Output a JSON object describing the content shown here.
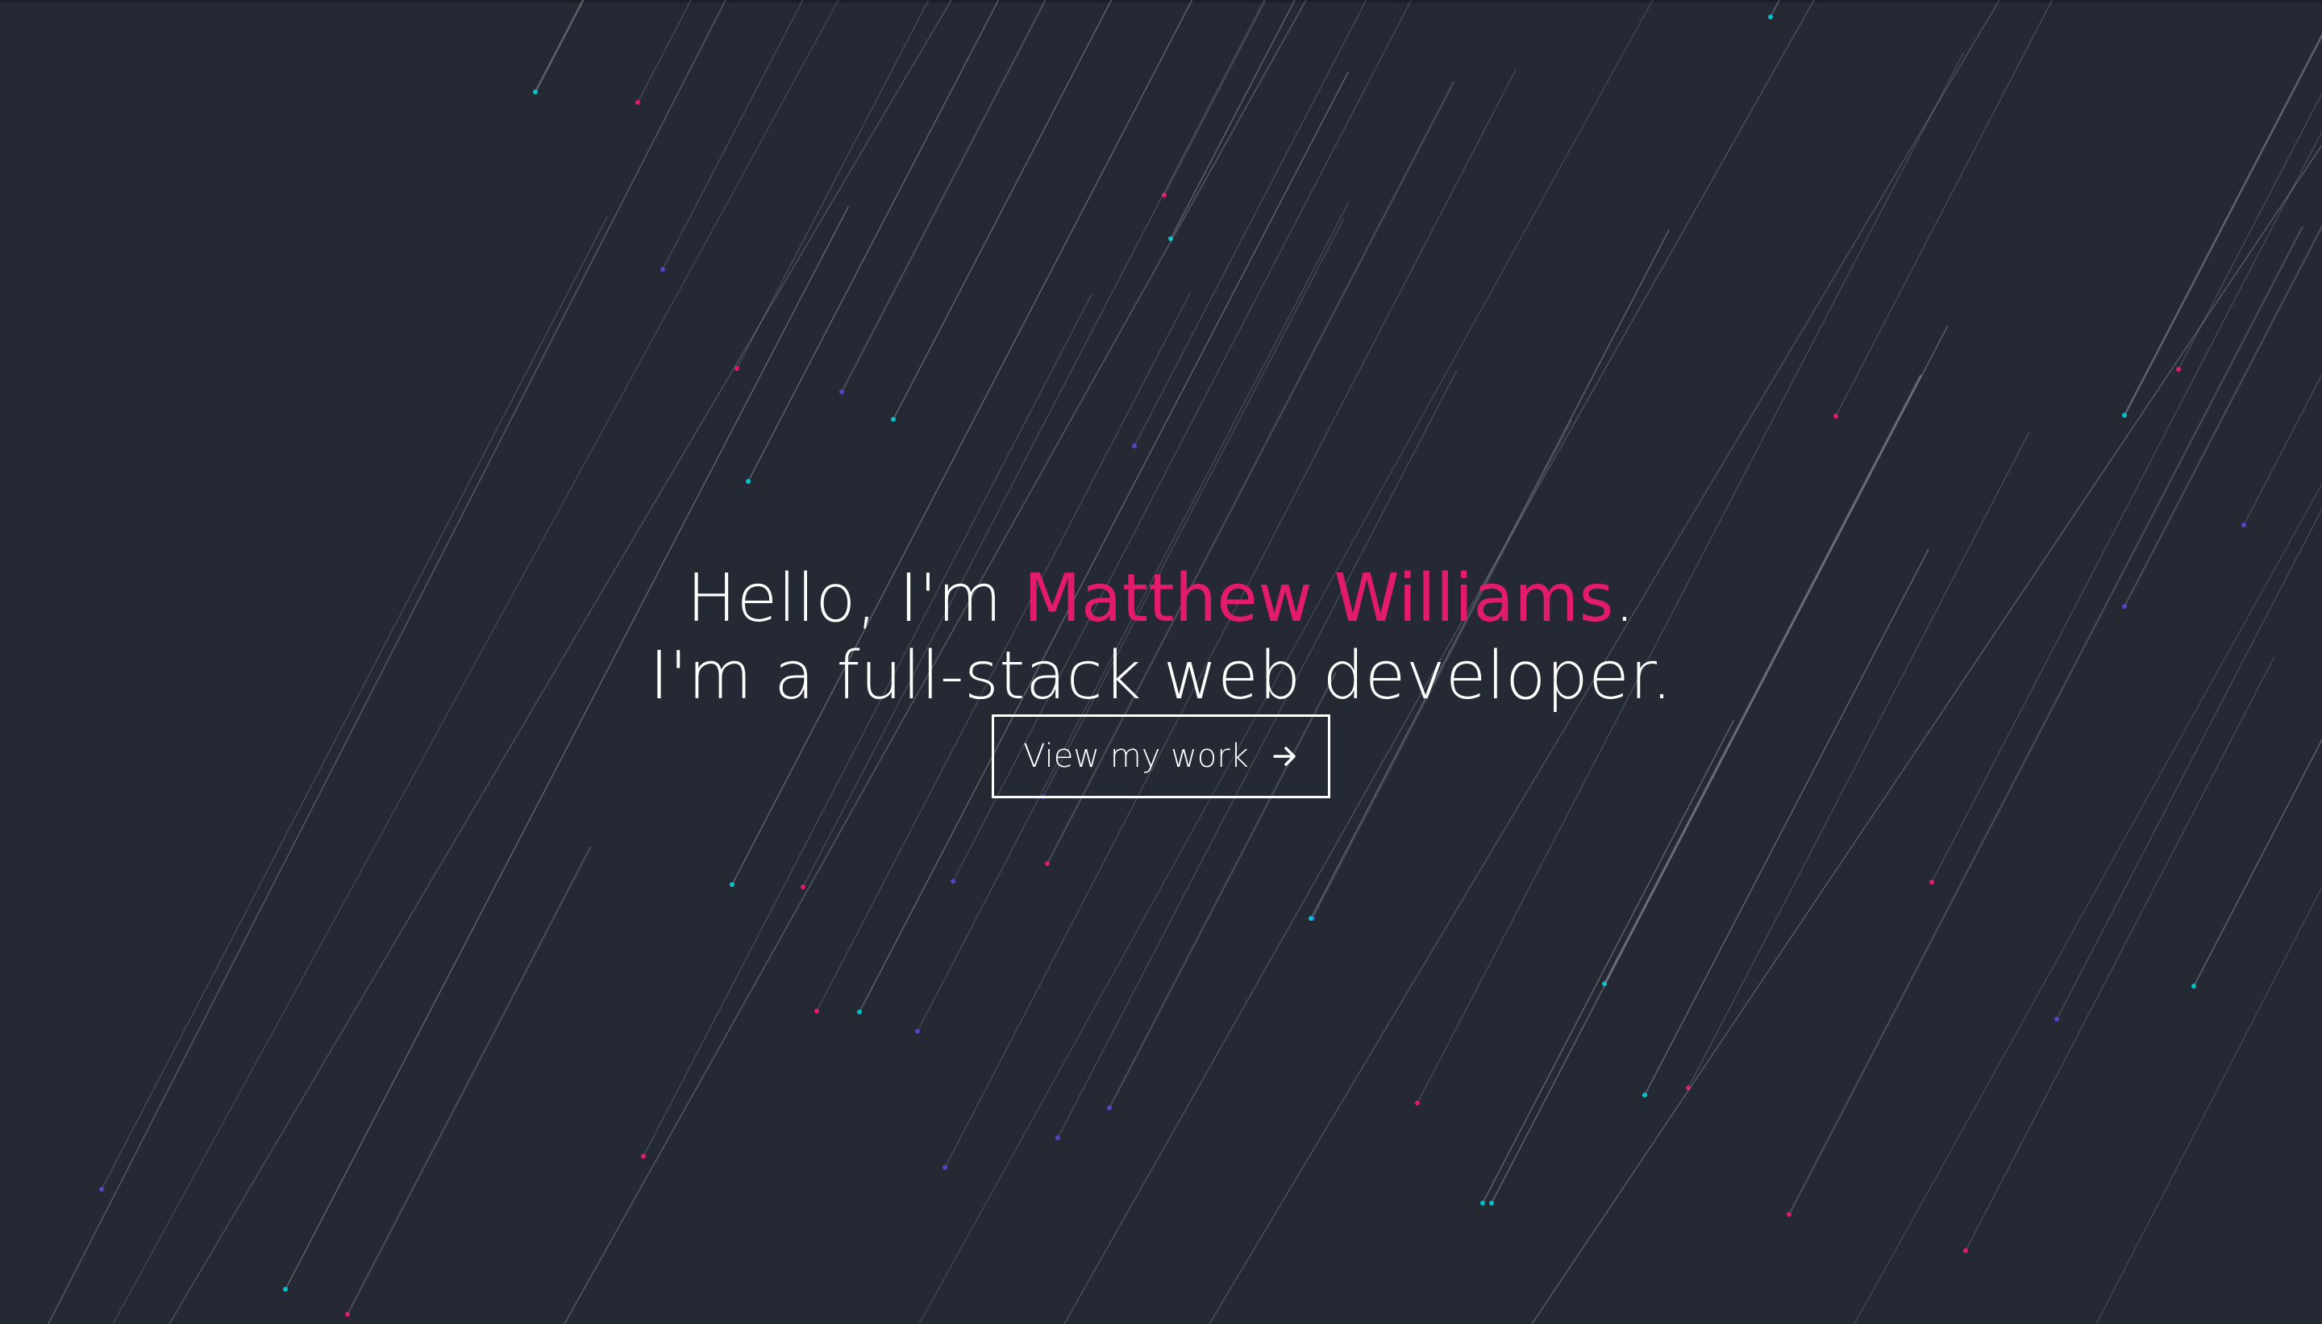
{
  "hero": {
    "greeting_prefix": "Hello, I'm ",
    "name": "Matthew Williams",
    "greeting_suffix": ".",
    "tagline": "I'm a full-stack web developer.",
    "cta_label": "View my work",
    "cta_icon": "arrow-right-icon"
  },
  "colors": {
    "background": "#252934",
    "accent": "#e31b6d",
    "text": "#ffffff",
    "particle_teal": "#04c2c9",
    "particle_pink": "#e31b6d",
    "particle_indigo": "#4f46c8",
    "streak": "#a7abbd"
  }
}
